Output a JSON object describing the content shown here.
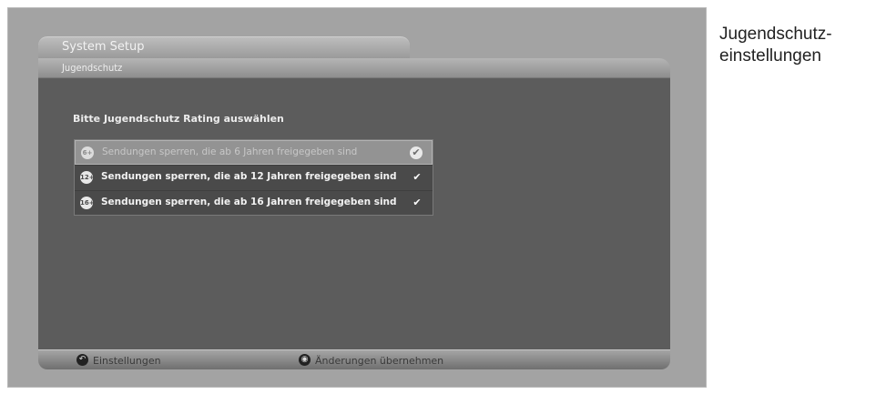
{
  "tabs": {
    "system_setup": "System Setup",
    "jugendschutz": "Jugendschutz"
  },
  "prompt": "Bitte Jugendschutz Rating auswählen",
  "options": [
    {
      "badge": "6+",
      "label": "Sendungen sperren, die ab 6 Jahren freigegeben sind",
      "selected": true,
      "icon": "check-icon"
    },
    {
      "badge": "12+",
      "label": "Sendungen sperren, die ab 12 Jahren freigegeben sind",
      "selected": false,
      "icon": "check-icon"
    },
    {
      "badge": "16+",
      "label": "Sendungen sperren, die ab 16 Jahren freigegeben sind",
      "selected": false,
      "icon": "check-icon"
    }
  ],
  "footer": {
    "back_label": "Einstellungen",
    "back_icon": "back-arrow-icon",
    "apply_label": "Änderungen übernehmen",
    "apply_icon": "ok-button-icon"
  },
  "side_caption": {
    "line1": "Jugendschutz-",
    "line2": "einstellungen"
  }
}
